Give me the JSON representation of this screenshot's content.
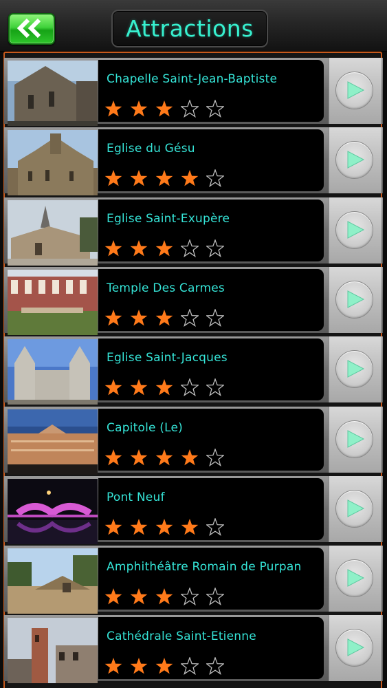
{
  "header": {
    "title": "Attractions",
    "back_icon": "double-chevron-left-icon"
  },
  "colors": {
    "accent_text": "#35e3d6",
    "star_filled": "#ff7a1a",
    "frame": "#c75a1d",
    "back_button": "#2fc52c"
  },
  "attractions": [
    {
      "name": "Chapelle Saint-Jean-Baptiste",
      "rating": 3,
      "max_rating": 5
    },
    {
      "name": "Eglise du Gésu",
      "rating": 4,
      "max_rating": 5
    },
    {
      "name": "Eglise Saint-Exupère",
      "rating": 3,
      "max_rating": 5
    },
    {
      "name": "Temple Des Carmes",
      "rating": 3,
      "max_rating": 5
    },
    {
      "name": "Eglise Saint-Jacques",
      "rating": 3,
      "max_rating": 5
    },
    {
      "name": "Capitole (Le)",
      "rating": 4,
      "max_rating": 5
    },
    {
      "name": "Pont Neuf",
      "rating": 4,
      "max_rating": 5
    },
    {
      "name": "Amphithéâtre Romain de Purpan",
      "rating": 3,
      "max_rating": 5
    },
    {
      "name": "Cathédrale Saint-Etienne",
      "rating": 3,
      "max_rating": 5
    }
  ]
}
